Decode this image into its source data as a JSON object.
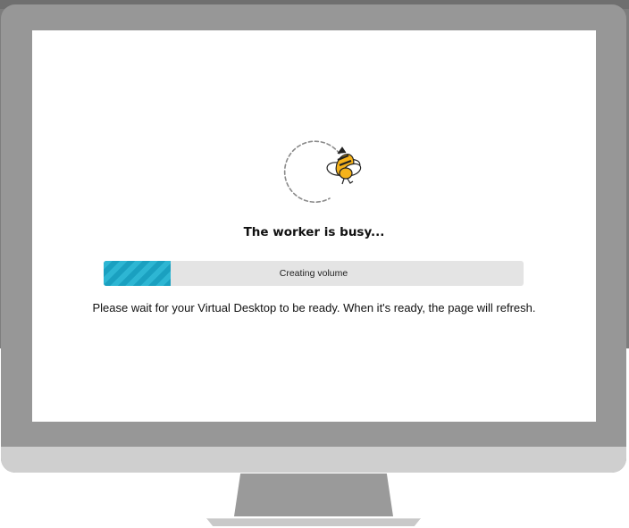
{
  "screen": {
    "title": "The worker is busy...",
    "progress": {
      "label": "Creating volume",
      "fraction": 0.16
    },
    "message": "Please wait for your Virtual Desktop to be ready. When it's ready, the page will refresh."
  },
  "icons": {
    "loader": "bee-spinner-icon"
  },
  "colors": {
    "progress_fill": "#1aa0c0",
    "progress_track": "#e4e4e4",
    "bee_yellow": "#f5b21a",
    "monitor_frame": "#979797"
  }
}
